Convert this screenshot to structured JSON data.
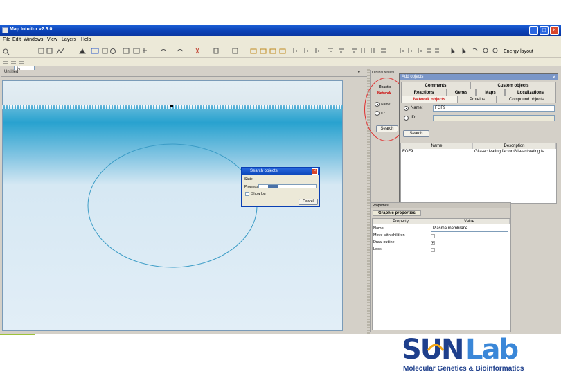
{
  "app": {
    "title": "Map Intuitor v2.6.0",
    "menu": [
      "File",
      "Edit",
      "Windows",
      "View",
      "Layers",
      "Help"
    ],
    "zoom_value": "%",
    "toolbar_right_label": "Energy layout"
  },
  "editor": {
    "tab_label": "Untitled",
    "close_glyph": "×"
  },
  "search_dialog": {
    "title": "Search objects",
    "status_label": "State",
    "progress_label": "Progress",
    "progress_fraction": 0.18,
    "show_log_label": "Show log",
    "cancel_label": "Cancel"
  },
  "side_strip": {
    "title": "Ordinal results",
    "tab_a": "Reactio",
    "tab_b": "Network",
    "name_label": "Name:",
    "id_label": "ID:",
    "search_short": "Search"
  },
  "add_objects": {
    "title": "Add objects",
    "tabs_row1": [
      "Comments",
      "Custom objects"
    ],
    "tabs_row2": [
      "Reactions",
      "Genes",
      "Maps",
      "Localizations"
    ],
    "tabs_row3": [
      "Network objects",
      "Proteins",
      "Compound objects"
    ],
    "name_label": "Name:",
    "name_value": "FGF9",
    "id_label": "ID:",
    "search_label": "Search",
    "columns": [
      "Name",
      "Description"
    ],
    "rows": [
      {
        "name": "FGF9",
        "description": "Glia-activating factor Glia-activating fa"
      }
    ]
  },
  "properties": {
    "header": "Properties",
    "tab": "Graphic properties",
    "columns": [
      "Property",
      "Value"
    ],
    "rows": [
      {
        "label": "Name",
        "value": "Plasma membrane"
      },
      {
        "label": "Move with children",
        "checked": false
      },
      {
        "label": "Draw outline",
        "checked": true
      },
      {
        "label": "Lock",
        "checked": false
      }
    ]
  },
  "logo": {
    "word_su": "SU",
    "word_n": "N",
    "word_lab": "Lab",
    "subtitle": "Molecular Genetics & Bioinformatics",
    "color_navy": "#1e3f8c",
    "color_blue": "#3a87d8",
    "color_orange": "#f2a516"
  }
}
